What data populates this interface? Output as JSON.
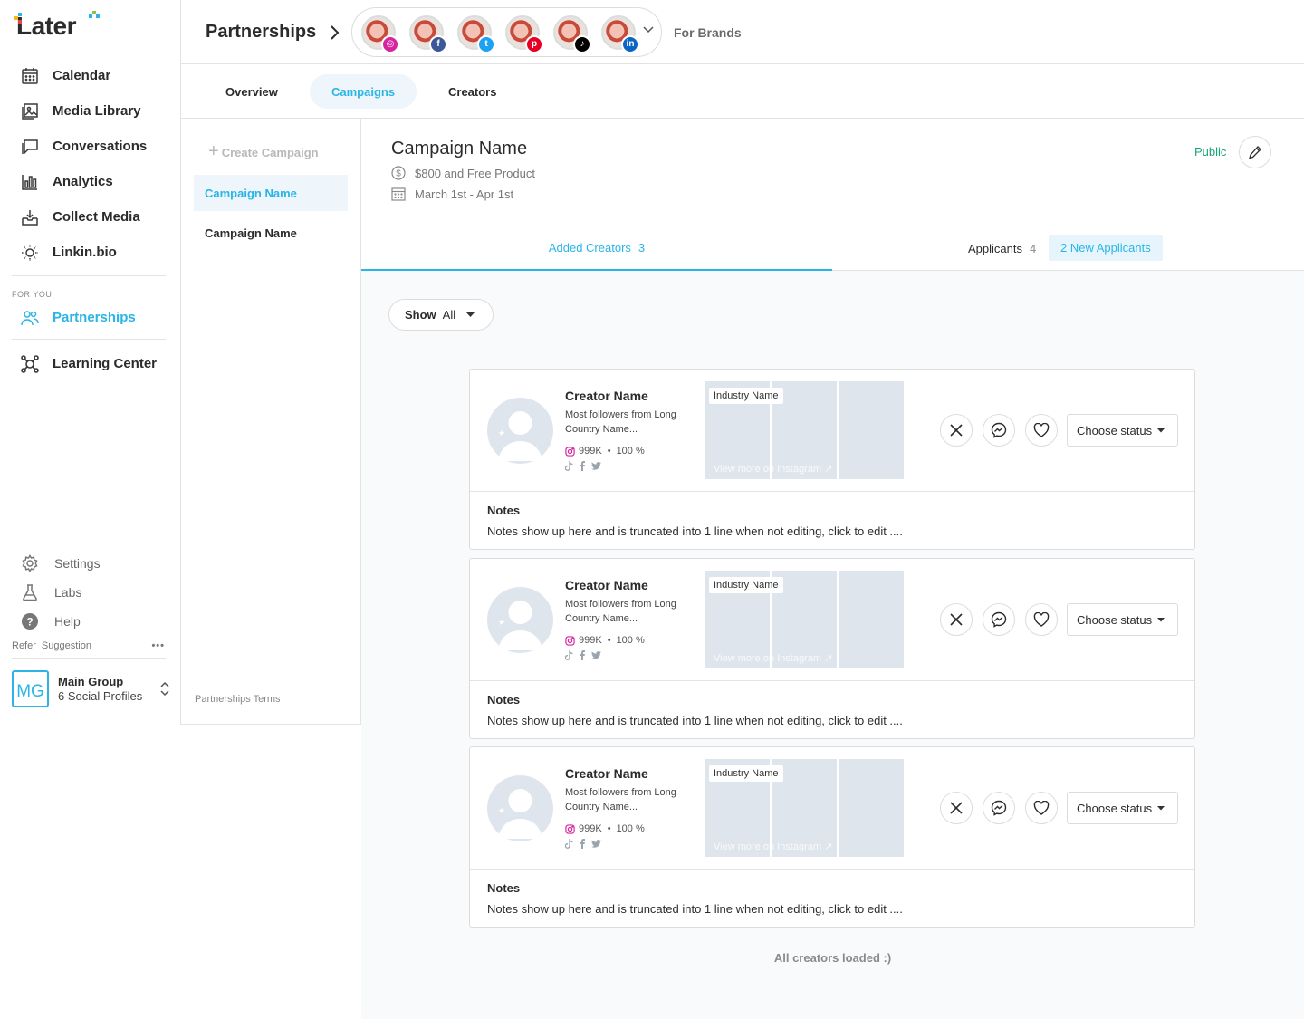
{
  "brand": {
    "logo_text": "Later"
  },
  "sidebar": {
    "items": [
      {
        "label": "Calendar",
        "icon": "calendar-icon"
      },
      {
        "label": "Media Library",
        "icon": "image-icon"
      },
      {
        "label": "Conversations",
        "icon": "chat-icon"
      },
      {
        "label": "Analytics",
        "icon": "bar-chart-icon"
      },
      {
        "label": "Collect Media",
        "icon": "download-tray-icon"
      },
      {
        "label": "Linkin.bio",
        "icon": "link-sun-icon"
      }
    ],
    "for_you_label": "FOR YOU",
    "partnerships_label": "Partnerships",
    "learning_label": "Learning Center",
    "bottom": [
      {
        "label": "Settings",
        "icon": "gear-icon"
      },
      {
        "label": "Labs",
        "icon": "flask-icon"
      },
      {
        "label": "Help",
        "icon": "help-icon"
      }
    ],
    "refer_label": "Refer",
    "suggestion_label": "Suggestion",
    "more_dots": "•••",
    "group": {
      "initials": "MG",
      "name": "Main Group",
      "profiles": "6 Social Profiles"
    }
  },
  "topbar": {
    "title": "Partnerships",
    "profiles": [
      {
        "network": "instagram",
        "color": "#d6249f"
      },
      {
        "network": "facebook",
        "color": "#3b5998"
      },
      {
        "network": "twitter",
        "color": "#1da1f2"
      },
      {
        "network": "pinterest",
        "color": "#e60023"
      },
      {
        "network": "tiktok",
        "color": "#000000"
      },
      {
        "network": "linkedin",
        "color": "#0a66c2"
      }
    ],
    "for_brands": "For Brands"
  },
  "tabs": [
    {
      "label": "Overview",
      "active": false
    },
    {
      "label": "Campaigns",
      "active": true
    },
    {
      "label": "Creators",
      "active": false
    }
  ],
  "campaign_list": {
    "create_label": "Create Campaign",
    "items": [
      {
        "label": "Campaign Name",
        "active": true
      },
      {
        "label": "Campaign Name",
        "active": false
      }
    ],
    "terms_label": "Partnerships Terms"
  },
  "campaign": {
    "title": "Campaign Name",
    "reward": "$800 and Free Product",
    "dates": "March 1st - Apr 1st",
    "visibility": "Public"
  },
  "sub_tabs": {
    "added_label": "Added Creators",
    "added_count": "3",
    "applicants_label": "Applicants",
    "applicants_count": "4",
    "new_applicants": "2 New Applicants"
  },
  "filter": {
    "show_label": "Show",
    "show_value": "All"
  },
  "creators": [
    {
      "name": "Creator Name",
      "desc": "Most followers from Long Country Name...",
      "followers": "999K",
      "engagement": "100 %",
      "industry": "Industry Name",
      "view_more": "View more on Instagram ↗",
      "status_label": "Choose status",
      "notes_title": "Notes",
      "notes_text": "Notes show up here and is truncated into 1 line when not editing, click to edit ...."
    },
    {
      "name": "Creator Name",
      "desc": "Most followers from Long Country Name...",
      "followers": "999K",
      "engagement": "100 %",
      "industry": "Industry Name",
      "view_more": "View more on Instagram ↗",
      "status_label": "Choose status",
      "notes_title": "Notes",
      "notes_text": "Notes show up here and is truncated into 1 line when not editing, click to edit ...."
    },
    {
      "name": "Creator Name",
      "desc": "Most followers from Long Country Name...",
      "followers": "999K",
      "engagement": "100 %",
      "industry": "Industry Name",
      "view_more": "View more on Instagram ↗",
      "status_label": "Choose status",
      "notes_title": "Notes",
      "notes_text": "Notes show up here and is truncated into 1 line when not editing, click to edit ...."
    }
  ],
  "footer": {
    "all_loaded": "All creators loaded :)"
  },
  "colors": {
    "accent": "#2ab5e6",
    "public": "#17a673",
    "placeholder": "#dfe5ec"
  }
}
